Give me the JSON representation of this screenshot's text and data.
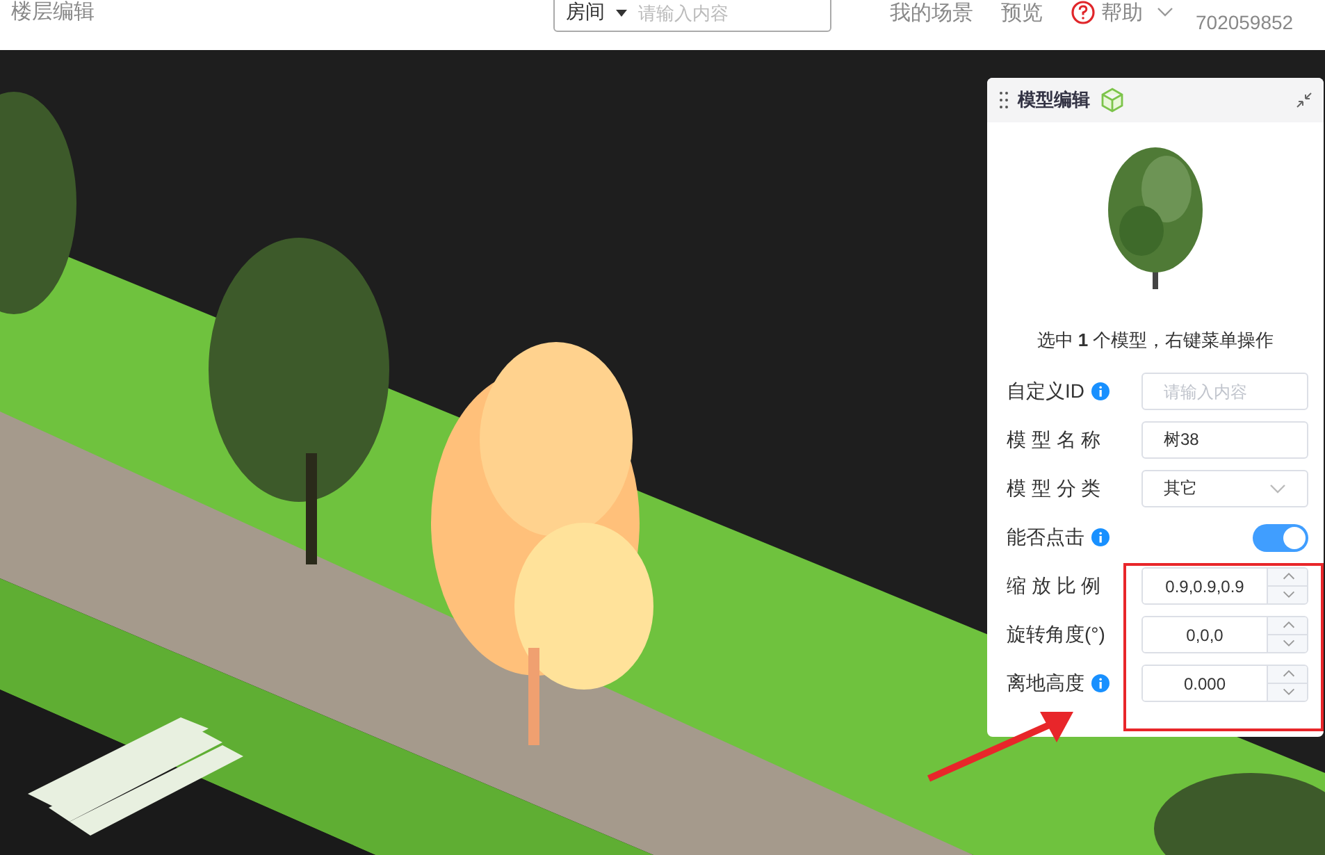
{
  "header": {
    "title": "楼层编辑",
    "search": {
      "scope": "房间",
      "placeholder": "请输入内容"
    },
    "nav": [
      {
        "label": "我的场景",
        "kind": "link"
      },
      {
        "label": "预览",
        "kind": "link"
      },
      {
        "label": "帮助",
        "kind": "help"
      }
    ],
    "group": {
      "number": "702059852"
    }
  },
  "panel": {
    "title": "模型编辑",
    "caption": "选中 **1** 个模型，右键菜单操作",
    "fields": [
      {
        "label": "自定义ID",
        "info": true,
        "kind": "text",
        "placeholder": "请输入内容"
      },
      {
        "label": "模 型 名 称",
        "info": false,
        "kind": "text",
        "value": "树38"
      },
      {
        "label": "模 型 分 类",
        "info": false,
        "kind": "select",
        "value": "其它"
      },
      {
        "label": "能否点击",
        "info": true,
        "kind": "switch",
        "on": true
      },
      {
        "label": "缩 放 比 例",
        "info": false,
        "kind": "number",
        "value": "0.9,0.9,0.9"
      },
      {
        "label": "旋转角度(°)",
        "info": false,
        "kind": "number",
        "value": "0,0,0"
      },
      {
        "label": "离地高度",
        "info": true,
        "kind": "number",
        "value": "0.000"
      }
    ]
  }
}
